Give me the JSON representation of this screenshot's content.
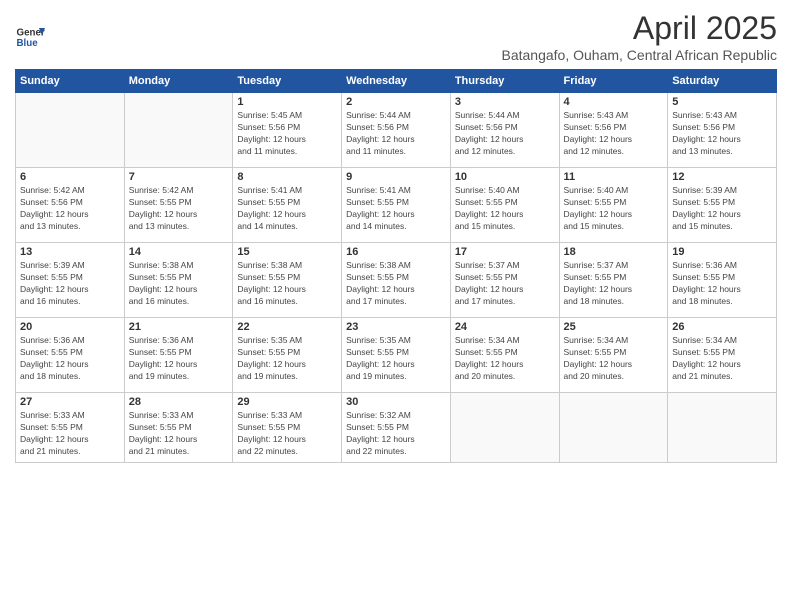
{
  "header": {
    "logo_general": "General",
    "logo_blue": "Blue",
    "month_title": "April 2025",
    "subtitle": "Batangafo, Ouham, Central African Republic"
  },
  "days_of_week": [
    "Sunday",
    "Monday",
    "Tuesday",
    "Wednesday",
    "Thursday",
    "Friday",
    "Saturday"
  ],
  "weeks": [
    [
      {
        "day": "",
        "info": ""
      },
      {
        "day": "",
        "info": ""
      },
      {
        "day": "1",
        "info": "Sunrise: 5:45 AM\nSunset: 5:56 PM\nDaylight: 12 hours\nand 11 minutes."
      },
      {
        "day": "2",
        "info": "Sunrise: 5:44 AM\nSunset: 5:56 PM\nDaylight: 12 hours\nand 11 minutes."
      },
      {
        "day": "3",
        "info": "Sunrise: 5:44 AM\nSunset: 5:56 PM\nDaylight: 12 hours\nand 12 minutes."
      },
      {
        "day": "4",
        "info": "Sunrise: 5:43 AM\nSunset: 5:56 PM\nDaylight: 12 hours\nand 12 minutes."
      },
      {
        "day": "5",
        "info": "Sunrise: 5:43 AM\nSunset: 5:56 PM\nDaylight: 12 hours\nand 13 minutes."
      }
    ],
    [
      {
        "day": "6",
        "info": "Sunrise: 5:42 AM\nSunset: 5:56 PM\nDaylight: 12 hours\nand 13 minutes."
      },
      {
        "day": "7",
        "info": "Sunrise: 5:42 AM\nSunset: 5:55 PM\nDaylight: 12 hours\nand 13 minutes."
      },
      {
        "day": "8",
        "info": "Sunrise: 5:41 AM\nSunset: 5:55 PM\nDaylight: 12 hours\nand 14 minutes."
      },
      {
        "day": "9",
        "info": "Sunrise: 5:41 AM\nSunset: 5:55 PM\nDaylight: 12 hours\nand 14 minutes."
      },
      {
        "day": "10",
        "info": "Sunrise: 5:40 AM\nSunset: 5:55 PM\nDaylight: 12 hours\nand 15 minutes."
      },
      {
        "day": "11",
        "info": "Sunrise: 5:40 AM\nSunset: 5:55 PM\nDaylight: 12 hours\nand 15 minutes."
      },
      {
        "day": "12",
        "info": "Sunrise: 5:39 AM\nSunset: 5:55 PM\nDaylight: 12 hours\nand 15 minutes."
      }
    ],
    [
      {
        "day": "13",
        "info": "Sunrise: 5:39 AM\nSunset: 5:55 PM\nDaylight: 12 hours\nand 16 minutes."
      },
      {
        "day": "14",
        "info": "Sunrise: 5:38 AM\nSunset: 5:55 PM\nDaylight: 12 hours\nand 16 minutes."
      },
      {
        "day": "15",
        "info": "Sunrise: 5:38 AM\nSunset: 5:55 PM\nDaylight: 12 hours\nand 16 minutes."
      },
      {
        "day": "16",
        "info": "Sunrise: 5:38 AM\nSunset: 5:55 PM\nDaylight: 12 hours\nand 17 minutes."
      },
      {
        "day": "17",
        "info": "Sunrise: 5:37 AM\nSunset: 5:55 PM\nDaylight: 12 hours\nand 17 minutes."
      },
      {
        "day": "18",
        "info": "Sunrise: 5:37 AM\nSunset: 5:55 PM\nDaylight: 12 hours\nand 18 minutes."
      },
      {
        "day": "19",
        "info": "Sunrise: 5:36 AM\nSunset: 5:55 PM\nDaylight: 12 hours\nand 18 minutes."
      }
    ],
    [
      {
        "day": "20",
        "info": "Sunrise: 5:36 AM\nSunset: 5:55 PM\nDaylight: 12 hours\nand 18 minutes."
      },
      {
        "day": "21",
        "info": "Sunrise: 5:36 AM\nSunset: 5:55 PM\nDaylight: 12 hours\nand 19 minutes."
      },
      {
        "day": "22",
        "info": "Sunrise: 5:35 AM\nSunset: 5:55 PM\nDaylight: 12 hours\nand 19 minutes."
      },
      {
        "day": "23",
        "info": "Sunrise: 5:35 AM\nSunset: 5:55 PM\nDaylight: 12 hours\nand 19 minutes."
      },
      {
        "day": "24",
        "info": "Sunrise: 5:34 AM\nSunset: 5:55 PM\nDaylight: 12 hours\nand 20 minutes."
      },
      {
        "day": "25",
        "info": "Sunrise: 5:34 AM\nSunset: 5:55 PM\nDaylight: 12 hours\nand 20 minutes."
      },
      {
        "day": "26",
        "info": "Sunrise: 5:34 AM\nSunset: 5:55 PM\nDaylight: 12 hours\nand 21 minutes."
      }
    ],
    [
      {
        "day": "27",
        "info": "Sunrise: 5:33 AM\nSunset: 5:55 PM\nDaylight: 12 hours\nand 21 minutes."
      },
      {
        "day": "28",
        "info": "Sunrise: 5:33 AM\nSunset: 5:55 PM\nDaylight: 12 hours\nand 21 minutes."
      },
      {
        "day": "29",
        "info": "Sunrise: 5:33 AM\nSunset: 5:55 PM\nDaylight: 12 hours\nand 22 minutes."
      },
      {
        "day": "30",
        "info": "Sunrise: 5:32 AM\nSunset: 5:55 PM\nDaylight: 12 hours\nand 22 minutes."
      },
      {
        "day": "",
        "info": ""
      },
      {
        "day": "",
        "info": ""
      },
      {
        "day": "",
        "info": ""
      }
    ]
  ]
}
